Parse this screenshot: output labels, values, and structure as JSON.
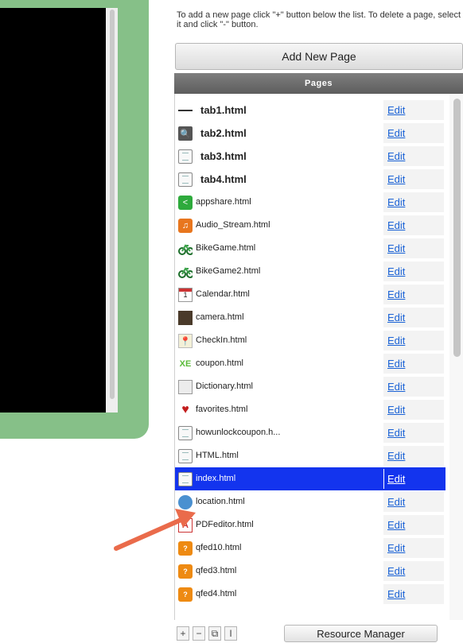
{
  "instructions": "To add a new page click \"+\" button below the list. To delete a page, select it and click \"-\" button.",
  "add_button_label": "Add New Page",
  "pages_header": "Pages",
  "edit_label": "Edit",
  "pages": [
    {
      "name": "tab1.html",
      "icon": "list-icon",
      "bold": true
    },
    {
      "name": "tab2.html",
      "icon": "search-icon",
      "bold": true
    },
    {
      "name": "tab3.html",
      "icon": "document-icon",
      "bold": true
    },
    {
      "name": "tab4.html",
      "icon": "document-icon",
      "bold": true
    },
    {
      "name": "appshare.html",
      "icon": "share-icon"
    },
    {
      "name": "Audio_Stream.html",
      "icon": "music-icon"
    },
    {
      "name": "BikeGame.html",
      "icon": "bike-icon"
    },
    {
      "name": "BikeGame2.html",
      "icon": "bike-icon"
    },
    {
      "name": "Calendar.html",
      "icon": "calendar-icon"
    },
    {
      "name": "camera.html",
      "icon": "camera-icon"
    },
    {
      "name": "CheckIn.html",
      "icon": "checkin-pin-icon"
    },
    {
      "name": "coupon.html",
      "icon": "coupon-icon"
    },
    {
      "name": "Dictionary.html",
      "icon": "dictionary-icon"
    },
    {
      "name": "favorites.html",
      "icon": "heart-icon"
    },
    {
      "name": "howunlockcoupon.h...",
      "icon": "document-icon"
    },
    {
      "name": "HTML.html",
      "icon": "document-icon"
    },
    {
      "name": "index.html",
      "icon": "document-icon",
      "selected": true
    },
    {
      "name": "location.html",
      "icon": "location-icon"
    },
    {
      "name": "PDFeditor.html",
      "icon": "pdf-icon"
    },
    {
      "name": "qfed10.html",
      "icon": "qfed-icon"
    },
    {
      "name": "qfed3.html",
      "icon": "qfed-icon"
    },
    {
      "name": "qfed4.html",
      "icon": "qfed-icon"
    }
  ],
  "toolbar": {
    "add": "+",
    "remove": "−",
    "duplicate": "⧉",
    "rename": "I"
  },
  "resource_button_label": "Resource Manager",
  "colors": {
    "selection": "#1334ee",
    "link": "#1a62d6",
    "device_frame": "#86c088",
    "arrow": "#ea6b4b"
  }
}
